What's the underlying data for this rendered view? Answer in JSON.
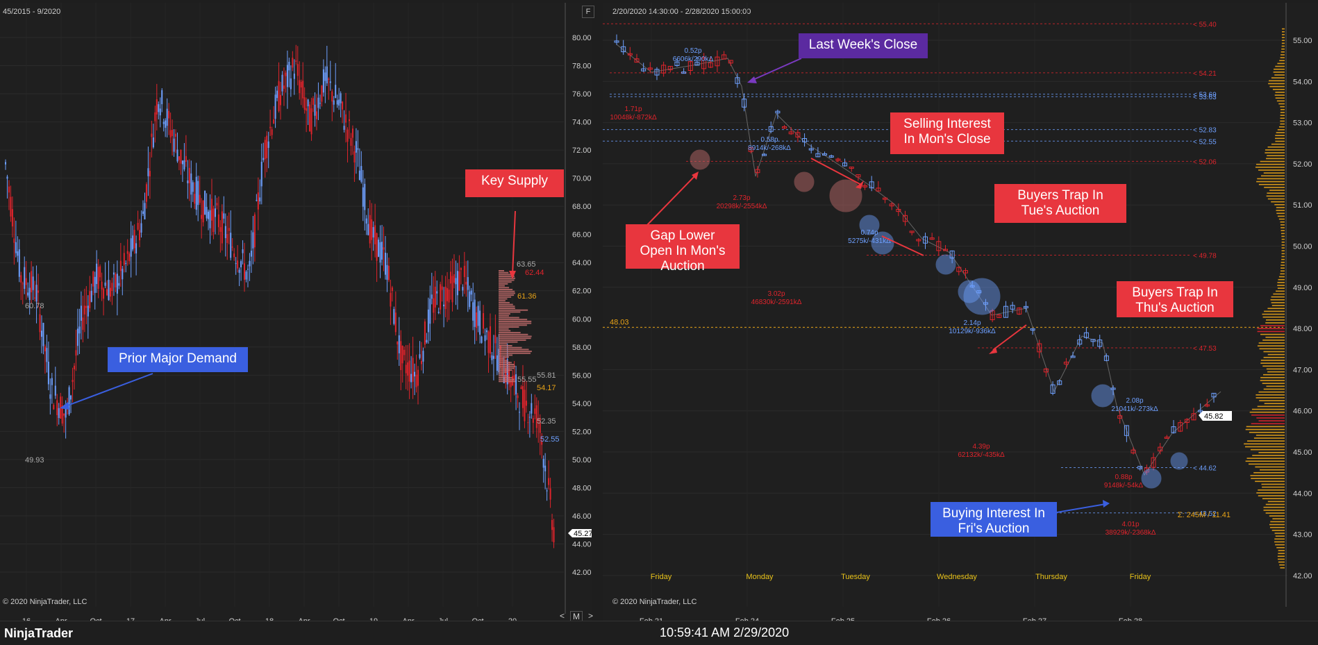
{
  "left_chart": {
    "range_label": "45/2015 - 9/2020",
    "copyright": "© 2020 NinjaTrader, LLC",
    "price_badge": "45.27",
    "y_ticks": [
      "80.00",
      "78.00",
      "76.00",
      "74.00",
      "72.00",
      "70.00",
      "68.00",
      "66.00",
      "64.00",
      "62.00",
      "60.00",
      "58.00",
      "56.00",
      "54.00",
      "52.00",
      "50.00",
      "48.00",
      "46.00",
      "44.00",
      "42.00"
    ],
    "x_ticks": [
      "16",
      "Apr",
      "Oct",
      "17",
      "Apr",
      "Jul",
      "Oct",
      "18",
      "Apr",
      "Oct",
      "19",
      "Apr",
      "Jul",
      "Oct",
      "20"
    ],
    "level_labels": [
      "60.78",
      "49.93",
      "63.65",
      "62.44",
      "61.36",
      "55.55",
      "55.81",
      "54.17",
      "52.35",
      "52.55"
    ],
    "nav": [
      "<",
      "M",
      ">"
    ],
    "f_button": "F"
  },
  "right_chart": {
    "range_label": "2/20/2020 14:30:00 - 2/28/2020 15:00:00",
    "copyright": "© 2020 NinjaTrader, LLC",
    "price_badge": "45.82",
    "volume_summary": "Σ: 245M / 11.41",
    "y_ticks": [
      "55.00",
      "54.00",
      "53.00",
      "52.00",
      "51.00",
      "50.00",
      "49.00",
      "48.00",
      "47.00",
      "46.00",
      "45.00",
      "44.00",
      "43.00",
      "42.00"
    ],
    "day_labels": [
      "Friday",
      "Monday",
      "Tuesday",
      "Wednesday",
      "Thursday",
      "Friday"
    ],
    "x_ticks": [
      "Feb 21",
      "Feb 24",
      "Feb 25",
      "Feb 26",
      "Feb 27",
      "Feb 28"
    ],
    "levels": [
      "< 55.40",
      "< 54.21",
      "< 53.69",
      "< 53.63",
      "< 52.83",
      "< 52.55",
      "< 52.06",
      "< 49.78",
      "< 47.53",
      "< 44.62",
      "< 43.52"
    ],
    "left_level": "48.03",
    "annotations": [
      {
        "top": "0.52p",
        "bottom": "6606k/290kΔ"
      },
      {
        "top": "1.71p",
        "bottom": "10048k/-872kΔ"
      },
      {
        "top": "0.58p",
        "bottom": "8914k/-268kΔ"
      },
      {
        "top": "2.73p",
        "bottom": "20298k/-2554kΔ"
      },
      {
        "top": "0.74p",
        "bottom": "5275k/-431kΔ"
      },
      {
        "top": "3.02p",
        "bottom": "46830k/-2591kΔ"
      },
      {
        "top": "2.14p",
        "bottom": "10129k/-936kΔ"
      },
      {
        "top": "4.39p",
        "bottom": "62132k/-435kΔ"
      },
      {
        "top": "2.08p",
        "bottom": "21041k/-273kΔ"
      },
      {
        "top": "0.88p",
        "bottom": "9148k/-54kΔ"
      },
      {
        "top": "4.01p",
        "bottom": "38929k/-2368kΔ"
      }
    ],
    "f_button": "F"
  },
  "callouts": {
    "key_supply": "Key Supply",
    "prior_demand": "Prior Major Demand",
    "last_week_close": "Last Week's Close",
    "selling_interest": "Selling Interest In Mon's Close",
    "gap_lower": "Gap Lower Open In Mon's Auction",
    "buyers_trap_tue": "Buyers Trap In Tue's Auction",
    "buyers_trap_thu": "Buyers Trap In Thu's Auction",
    "buying_interest": "Buying Interest In Fri's Auction"
  },
  "status": {
    "brand": "NinjaTrader",
    "clock": "10:59:41 AM 2/29/2020"
  },
  "chart_data": [
    {
      "type": "candlestick",
      "title": "",
      "x_range": [
        "2015",
        "2020-09"
      ],
      "ylim": [
        42,
        80
      ],
      "series": [
        {
          "name": "",
          "values": [
            71,
            63,
            62,
            55,
            53,
            60,
            63,
            62,
            64,
            67,
            76,
            73,
            70,
            68,
            67,
            65,
            63,
            72,
            76,
            78,
            74,
            77,
            75,
            72,
            66,
            64,
            57,
            56,
            61,
            62,
            63,
            60,
            58,
            56,
            54,
            53,
            45
          ]
        }
      ],
      "grid": true
    },
    {
      "type": "candlestick",
      "title": "",
      "x": [
        "Feb 21",
        "Feb 24",
        "Feb 25",
        "Feb 26",
        "Feb 27",
        "Feb 28"
      ],
      "ylim": [
        42,
        55.5
      ],
      "series": [
        {
          "name": "",
          "values": [
            54.0,
            52.0,
            51.0,
            49.8,
            47.0,
            45.8
          ]
        }
      ],
      "grid": true
    }
  ]
}
